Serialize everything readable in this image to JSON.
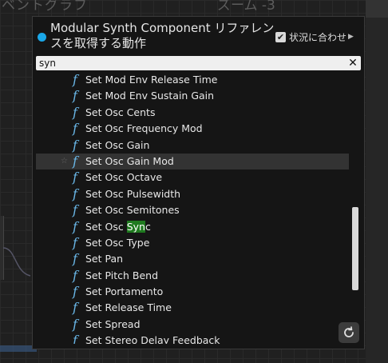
{
  "background": {
    "title": "ベントグラフ",
    "zoom": "ズーム -3"
  },
  "menu": {
    "title": "Modular Synth Component リファレンスを取得する動作",
    "context_sensitive_label": "状況に合わせ",
    "context_sensitive_checked": true,
    "search_value": "syn",
    "items": [
      {
        "label": "Set Mod Env Release Time"
      },
      {
        "label": "Set Mod Env Sustain Gain"
      },
      {
        "label": "Set Osc Cents"
      },
      {
        "label": "Set Osc Frequency Mod"
      },
      {
        "label": "Set Osc Gain"
      },
      {
        "label": "Set Osc Gain Mod",
        "selected": true
      },
      {
        "label": "Set Osc Octave"
      },
      {
        "label": "Set Osc Pulsewidth"
      },
      {
        "label": "Set Osc Semitones"
      },
      {
        "label": "Set Osc Sync",
        "prefix": "Set Osc ",
        "match": "Syn",
        "suffix": "c"
      },
      {
        "label": "Set Osc Type"
      },
      {
        "label": "Set Pan"
      },
      {
        "label": "Set Pitch Bend"
      },
      {
        "label": "Set Portamento"
      },
      {
        "label": "Set Release Time"
      },
      {
        "label": "Set Spread"
      },
      {
        "label": "Set Stereo Delay Feedback"
      }
    ],
    "function_icon": "function-icon",
    "highlight_color": "#1f7a1f",
    "accent_color": "#1aa7e8"
  }
}
